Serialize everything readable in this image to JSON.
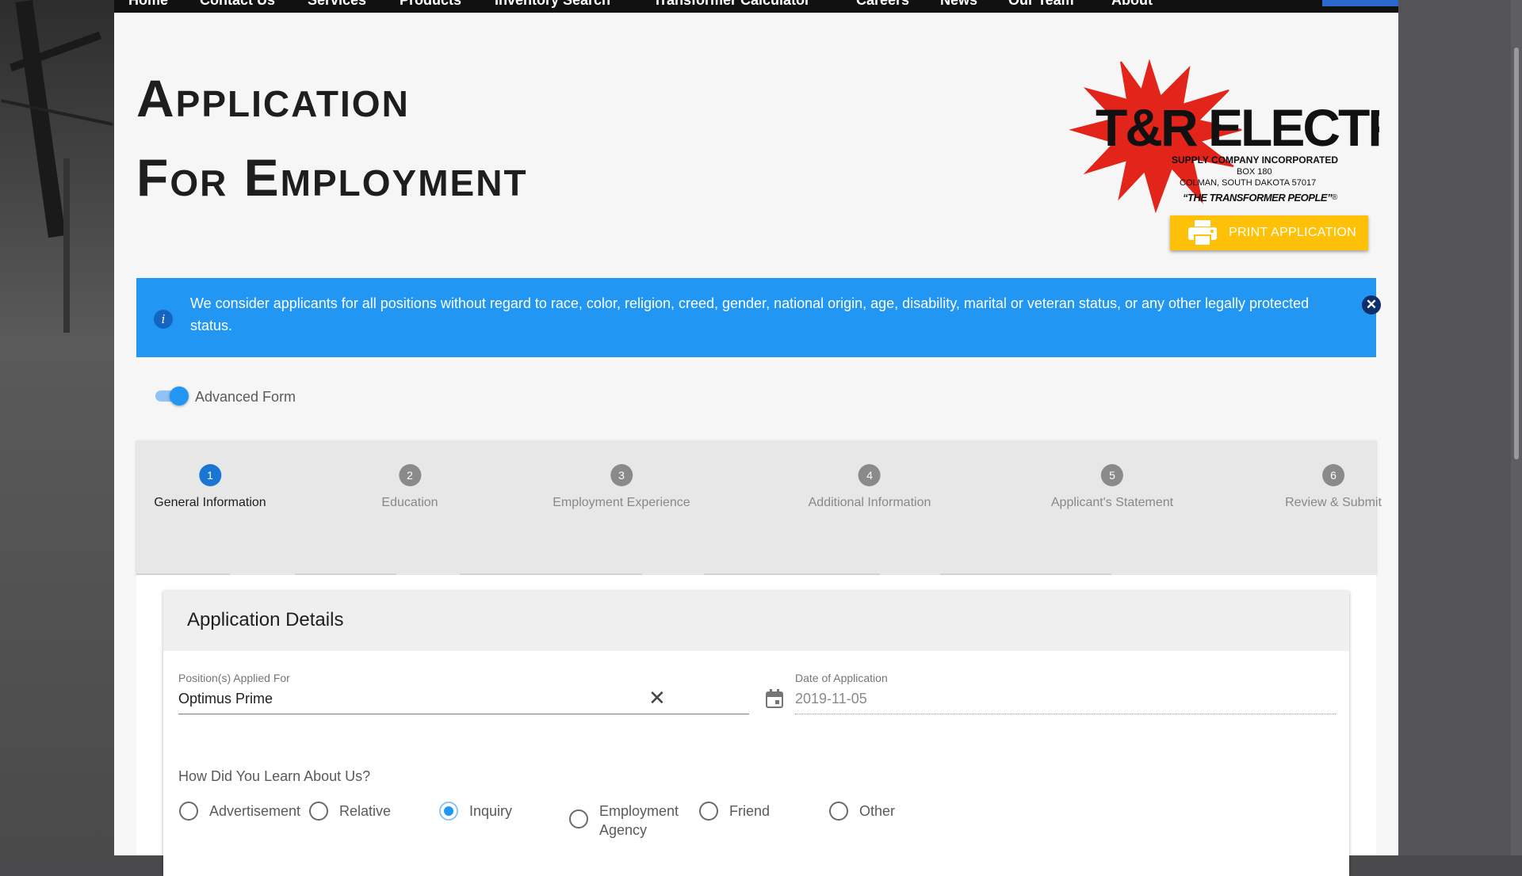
{
  "nav": {
    "items": [
      "Home",
      "Contact Us",
      "Services",
      "Products",
      "Inventory Search",
      "Transformer Calculator",
      "Careers",
      "News",
      "Our Team",
      "About"
    ]
  },
  "header": {
    "title_line1": "Application",
    "title_line2": "For Employment"
  },
  "logo": {
    "name": "T&R ELECTRIC",
    "line1": "SUPPLY COMPANY INCORPORATED",
    "line2": "BOX 180",
    "line3": "COLMAN, SOUTH DAKOTA 57017",
    "tagline": "“THE TRANSFORMER PEOPLE”",
    "mark": "®",
    "colors": {
      "star": "#e3241b",
      "text": "#111111"
    }
  },
  "print_button": {
    "label": "PRINT APPLICATION",
    "icon": "printer-icon",
    "color": "#ffc107"
  },
  "alert": {
    "message": "We consider applicants for all positions without regard to race, color, religion, creed, gender, national origin, age, disability, marital or veteran status, or any other legally protected status.",
    "info_glyph": "i",
    "close_glyph": "✕",
    "color": "#2196f3"
  },
  "advanced_form": {
    "label": "Advanced Form",
    "enabled": true
  },
  "steps": [
    {
      "num": "1",
      "label": "General Information",
      "active": true
    },
    {
      "num": "2",
      "label": "Education",
      "active": false
    },
    {
      "num": "3",
      "label": "Employment Experience",
      "active": false
    },
    {
      "num": "4",
      "label": "Additional Information",
      "active": false
    },
    {
      "num": "5",
      "label": "Applicant's Statement",
      "active": false
    },
    {
      "num": "6",
      "label": "Review & Submit",
      "active": false
    }
  ],
  "card": {
    "title": "Application Details",
    "position_field": {
      "label": "Position(s) Applied For",
      "value": "Optimus Prime",
      "clear_glyph": "✕"
    },
    "date_field": {
      "label": "Date of Application",
      "value": "2019-11-05",
      "icon": "calendar-icon"
    },
    "learn_question": "How Did You Learn About Us?",
    "learn_options": [
      {
        "label": "Advertisement",
        "checked": false
      },
      {
        "label": "Relative",
        "checked": false
      },
      {
        "label": "Inquiry",
        "checked": true
      },
      {
        "label": "Employment\nAgency",
        "checked": false
      },
      {
        "label": "Friend",
        "checked": false
      },
      {
        "label": "Other",
        "checked": false
      }
    ]
  }
}
